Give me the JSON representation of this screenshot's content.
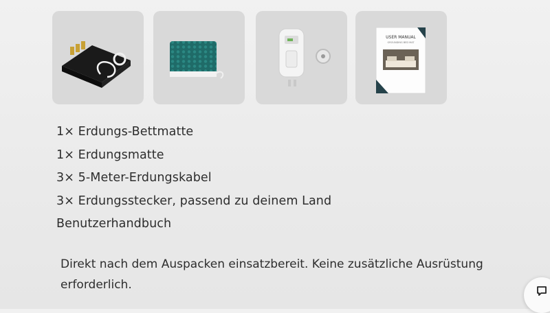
{
  "products": [
    {
      "icon": "bed-mat-icon",
      "alt": "grounding bed mat"
    },
    {
      "icon": "grounding-mat-icon",
      "alt": "grounding mat"
    },
    {
      "icon": "plug-tester-icon",
      "alt": "grounding plug"
    },
    {
      "icon": "manual-book-icon",
      "alt": "user manual",
      "book_title": "USER MANUAL",
      "book_subtitle": "GROUNDING BED MAT"
    }
  ],
  "contents": [
    "1× Erdungs-Bettmatte",
    "1× Erdungsmatte",
    "3× 5-Meter-Erdungskabel",
    "3× Erdungsstecker, passend zu deinem Land",
    "Benutzerhandbuch"
  ],
  "description": "Direkt nach dem Auspacken einsatzbereit. Keine zusätzliche Ausrüstung erforderlich.",
  "chat_button": {
    "icon": "chat-bubble-icon"
  }
}
